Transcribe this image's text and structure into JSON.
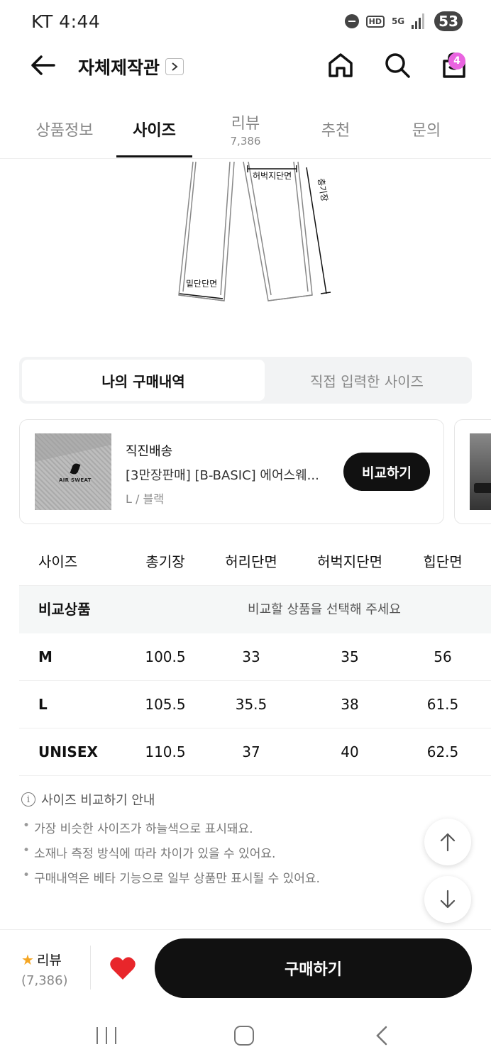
{
  "status_bar": {
    "carrier_time": "KT 4:44",
    "hd": "HD",
    "network": "5G",
    "battery": "53"
  },
  "header": {
    "store_title": "자체제작관",
    "cart_count": "4"
  },
  "tabs": [
    {
      "label": "상품정보",
      "sub": ""
    },
    {
      "label": "사이즈",
      "sub": ""
    },
    {
      "label": "리뷰",
      "sub": "7,386"
    },
    {
      "label": "추천",
      "sub": ""
    },
    {
      "label": "문의",
      "sub": ""
    }
  ],
  "active_tab": "사이즈",
  "illustration": {
    "thigh_label": "허벅지단면",
    "length_label": "총기장",
    "hem_label": "밑단단면"
  },
  "toggle": {
    "selected": "나의 구매내역",
    "other": "직접 입력한 사이즈"
  },
  "product": {
    "brand": "직진배송",
    "name": "[3만장판매] [B-BASIC] 에어스웨...",
    "option": "L / 블랙",
    "thumb_text": "AIR SWEAT",
    "compare_button": "비교하기"
  },
  "size_table": {
    "headers": [
      "사이즈",
      "총기장",
      "허리단면",
      "허벅지단면",
      "힙단면"
    ],
    "compare_row": {
      "label": "비교상품",
      "message": "비교할 상품을 선택해 주세요"
    },
    "rows": [
      {
        "size": "M",
        "length": "100.5",
        "waist": "33",
        "thigh": "35",
        "hip": "56"
      },
      {
        "size": "L",
        "length": "105.5",
        "waist": "35.5",
        "thigh": "38",
        "hip": "61.5"
      },
      {
        "size": "UNISEX",
        "length": "110.5",
        "waist": "37",
        "thigh": "40",
        "hip": "62.5"
      }
    ]
  },
  "guide": {
    "title": "사이즈 비교하기 안내",
    "items": [
      "가장 비슷한 사이즈가 하늘색으로 표시돼요.",
      "소재나 측정 방식에 따라 차이가 있을 수 있어요.",
      "구매내역은 베타 기능으로 일부 상품만 표시될 수 있어요."
    ]
  },
  "bottom_bar": {
    "review_label": "리뷰",
    "review_count": "(7,386)",
    "buy_button": "구매하기"
  },
  "colors": {
    "accent": "#111111",
    "badge": "#e964e0",
    "heart": "#e8262b",
    "star": "#f5a623"
  }
}
